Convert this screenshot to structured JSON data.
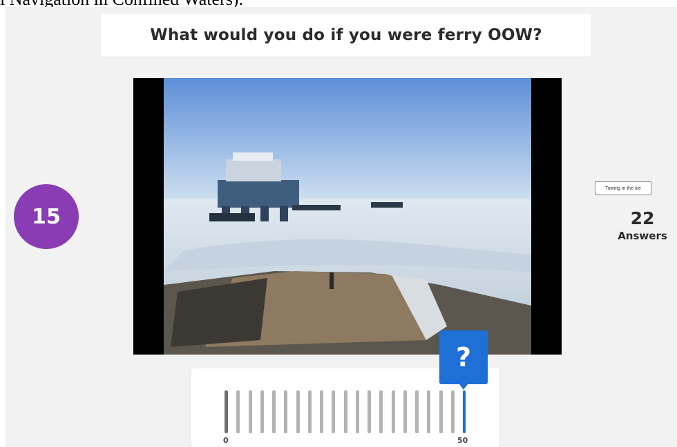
{
  "page_header_text": "l Navigation in Confined Waters).",
  "question": {
    "title": "What would you do if you were ferry OOW?"
  },
  "timer": {
    "value": "15"
  },
  "answers": {
    "count": "22",
    "label": "Answers"
  },
  "media": {
    "caption": "Towing in the ice"
  },
  "slider": {
    "min_label": "0",
    "max_label": "50",
    "marker_label": "?",
    "value_fraction": 1.0,
    "accent_color": "#1e6fd6"
  },
  "colors": {
    "timer_bg": "#8a3cb5",
    "marker_bg": "#1e6fd6",
    "stage_bg": "#f2f2f2"
  }
}
